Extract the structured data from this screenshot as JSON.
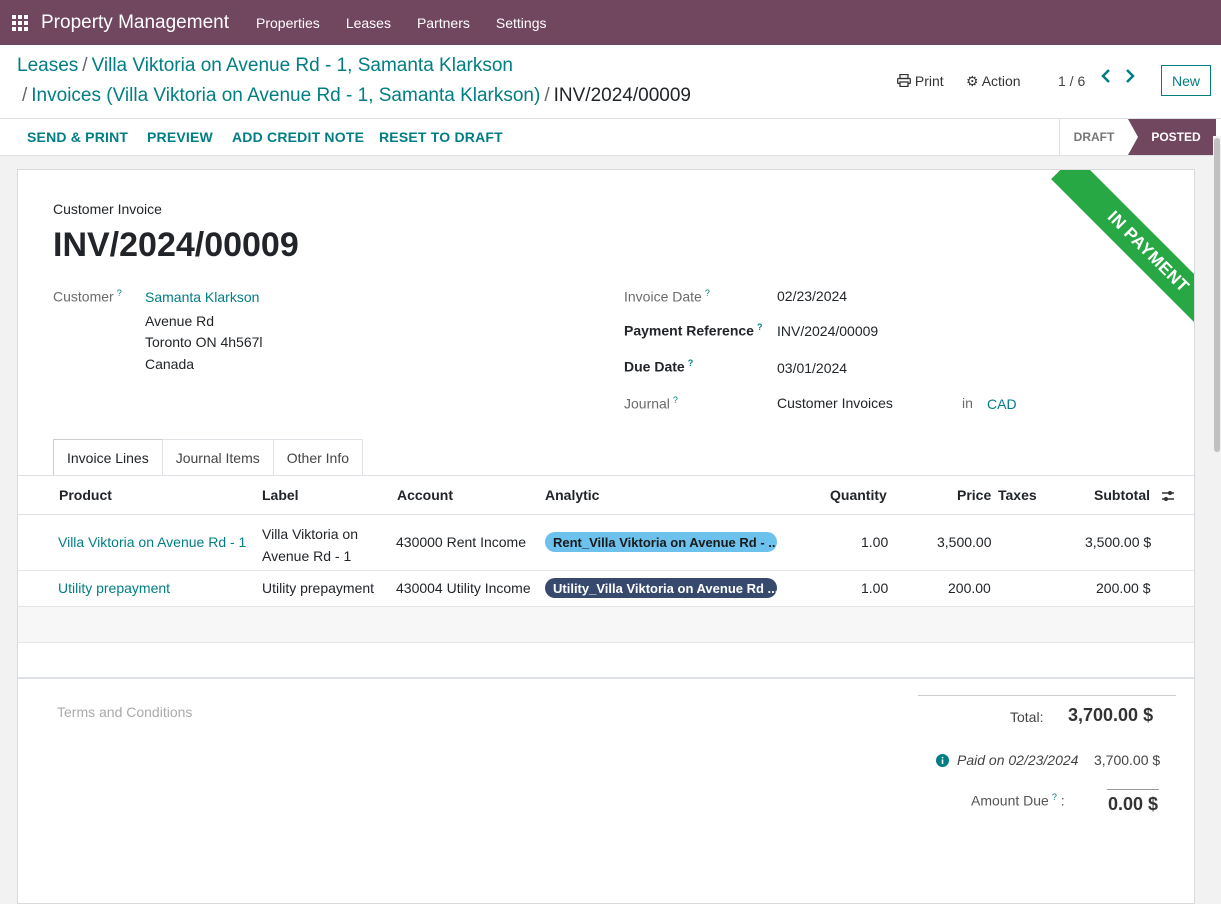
{
  "navbar": {
    "app_name": "Property Management",
    "menu": [
      "Properties",
      "Leases",
      "Partners",
      "Settings"
    ]
  },
  "breadcrumb": {
    "items": [
      "Leases",
      "Villa Viktoria on Avenue Rd - 1, Samanta Klarkson",
      "Invoices (Villa Viktoria on Avenue Rd - 1, Samanta Klarkson)"
    ],
    "current": "INV/2024/00009"
  },
  "control": {
    "print_label": "Print",
    "action_label": "Action",
    "pager": "1 / 6",
    "new_label": "New"
  },
  "statusbar": {
    "buttons": [
      "SEND & PRINT",
      "PREVIEW",
      "ADD CREDIT NOTE",
      "RESET TO DRAFT"
    ],
    "stages": [
      "DRAFT",
      "POSTED"
    ],
    "active_stage": "POSTED"
  },
  "invoice": {
    "ribbon": "IN PAYMENT",
    "type": "Customer Invoice",
    "name": "INV/2024/00009",
    "customer_label": "Customer",
    "customer_name": "Samanta Klarkson",
    "address": [
      "Avenue Rd",
      "Toronto ON 4h567l",
      "Canada"
    ],
    "invoice_date_label": "Invoice Date",
    "invoice_date": "02/23/2024",
    "payment_ref_label": "Payment Reference",
    "payment_ref": "INV/2024/00009",
    "due_date_label": "Due Date",
    "due_date": "03/01/2024",
    "journal_label": "Journal",
    "journal": "Customer Invoices",
    "in_label": "in",
    "currency": "CAD"
  },
  "tabs": [
    "Invoice Lines",
    "Journal Items",
    "Other Info"
  ],
  "table": {
    "headers": [
      "Product",
      "Label",
      "Account",
      "Analytic",
      "Quantity",
      "Price",
      "Taxes",
      "Subtotal"
    ],
    "rows": [
      {
        "product": "Villa Viktoria on Avenue Rd - 1",
        "label": "Villa Viktoria on Avenue Rd - 1",
        "account": "430000 Rent Income",
        "analytic": "Rent_Villa Viktoria on Avenue Rd - ...",
        "quantity": "1.00",
        "price": "3,500.00",
        "subtotal": "3,500.00 $"
      },
      {
        "product": "Utility prepayment",
        "label": "Utility prepayment",
        "account": "430004 Utility Income",
        "analytic": "Utility_Villa Viktoria on Avenue Rd ...",
        "quantity": "1.00",
        "price": "200.00",
        "subtotal": "200.00 $"
      }
    ]
  },
  "footer": {
    "terms_placeholder": "Terms and Conditions",
    "total_label": "Total:",
    "total": "3,700.00 $",
    "paid_text": "Paid on 02/23/2024",
    "paid_amount": "3,700.00 $",
    "amount_due_label": "Amount Due",
    "amount_due": "0.00 $"
  },
  "colors": {
    "brand": "#71465f",
    "link": "#017e84",
    "ribbon": "#28a745",
    "tag_rent": "#6cc1ed",
    "tag_utility": "#374a6d"
  }
}
